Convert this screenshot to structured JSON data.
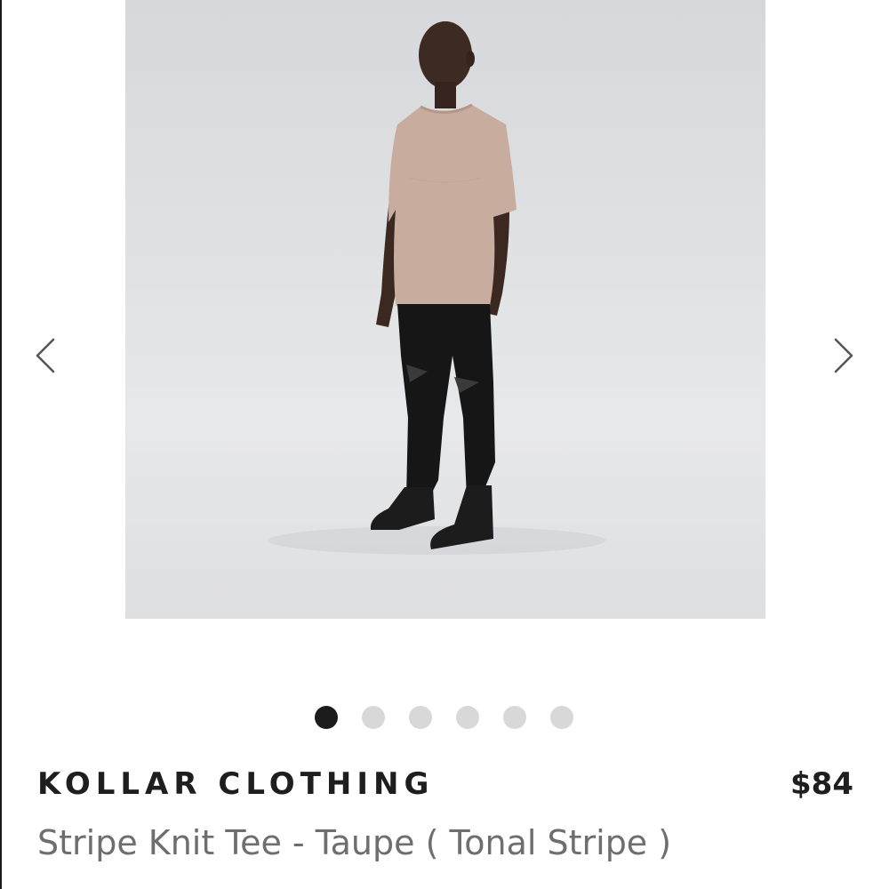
{
  "product": {
    "image": {
      "alt": "model-wearing-taupe-tee-and-black-distressed-jeans"
    },
    "brand": "KOLLAR CLOTHING",
    "price": "$84",
    "name": "Stripe Knit Tee - Taupe ( Tonal Stripe )"
  },
  "carousel": {
    "prev_icon": "chevron-left-icon",
    "next_icon": "chevron-right-icon",
    "slides_total": 6,
    "active_index": 0
  },
  "colors": {
    "dot_active": "#1b1b1b",
    "dot_inactive": "#d8d8d8",
    "brand_text": "#1e1e1e",
    "name_text": "#6e6e6e"
  }
}
